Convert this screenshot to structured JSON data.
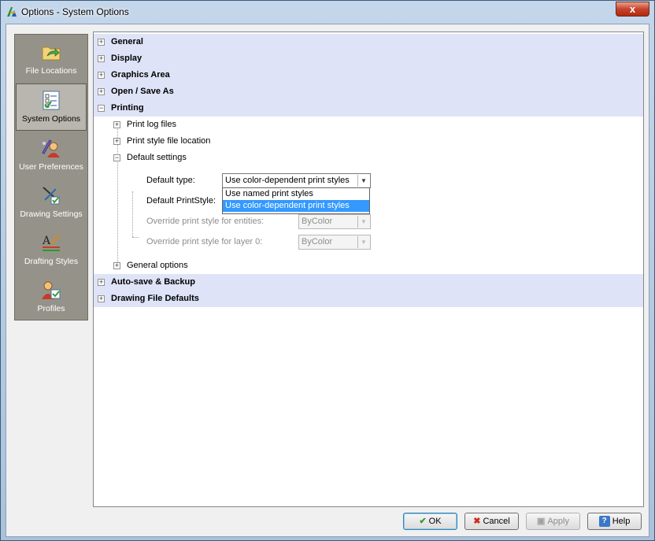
{
  "window": {
    "title": "Options - System Options",
    "close_label": "x"
  },
  "sidebar": {
    "items": [
      {
        "label": "File Locations",
        "icon": "folder-arrow-icon",
        "selected": false
      },
      {
        "label": "System Options",
        "icon": "checklist-icon",
        "selected": true
      },
      {
        "label": "User Preferences",
        "icon": "user-pencil-icon",
        "selected": false
      },
      {
        "label": "Drawing Settings",
        "icon": "drawing-tools-icon",
        "selected": false
      },
      {
        "label": "Drafting Styles",
        "icon": "text-style-icon",
        "selected": false
      },
      {
        "label": "Profiles",
        "icon": "profile-user-icon",
        "selected": false
      }
    ]
  },
  "tree": {
    "general": "General",
    "display": "Display",
    "graphics_area": "Graphics Area",
    "open_save": "Open / Save As",
    "printing": "Printing",
    "print_log_files": "Print log files",
    "print_style_location": "Print style file location",
    "default_settings": "Default settings",
    "general_options": "General options",
    "autosave": "Auto-save & Backup",
    "drawing_defaults": "Drawing File Defaults"
  },
  "fields": {
    "default_type_label": "Default type:",
    "default_type_value": "Use color-dependent print styles",
    "default_printstyle_label": "Default PrintStyle:",
    "override_entities_label": "Override print style for entities:",
    "override_entities_value": "ByColor",
    "override_layer0_label": "Override print style for layer 0:",
    "override_layer0_value": "ByColor"
  },
  "dropdown": {
    "options": [
      "Use named print styles",
      "Use color-dependent print styles"
    ],
    "highlighted": "Use color-dependent print styles"
  },
  "buttons": {
    "ok": "OK",
    "cancel": "Cancel",
    "apply": "Apply",
    "help": "Help"
  },
  "colors": {
    "category_bg": "#dfe3f8",
    "highlight": "#3399ff",
    "sidebar_bg": "#959389"
  }
}
